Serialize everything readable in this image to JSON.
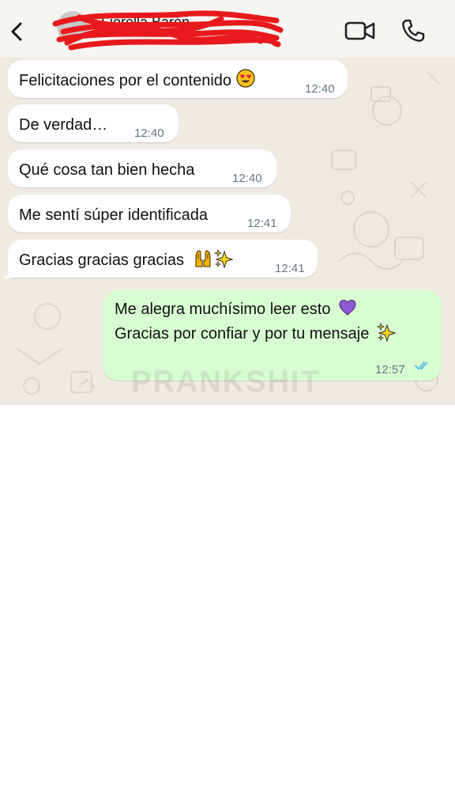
{
  "chat": {
    "contact_name": "Fiorella Barón",
    "messages_in": [
      {
        "text": "Felicitaciones por el contenido",
        "time": "12:40"
      },
      {
        "text": "De verdad…",
        "time": "12:40"
      },
      {
        "text": "Qué cosa tan bien hecha",
        "time": "12:40"
      },
      {
        "text": "Me sentí súper identificada",
        "time": "12:41"
      },
      {
        "text": "Gracias gracias gracias",
        "time": "12:41"
      }
    ],
    "message_out": {
      "line1": "Me alegra muchísimo leer esto",
      "line2": "Gracias por confiar y por tu mensaje",
      "time": "12:57",
      "status": "read"
    }
  },
  "icons": {
    "back": "chevron-left-icon",
    "video": "video-camera-icon",
    "call": "phone-icon",
    "heart_eyes": "heart-eyes-emoji",
    "raising_hands": "raising-hands-emoji",
    "sparkles": "sparkles-emoji",
    "purple_heart": "purple-heart-emoji",
    "read_receipt": "double-check-icon"
  },
  "watermark": "PRANKSHIT",
  "colors": {
    "wallpaper": "#efeae2",
    "incoming_bubble": "#ffffff",
    "outgoing_bubble": "#d9fdd3",
    "timestamp": "#667781",
    "read_tick": "#53bdeb",
    "redaction": "#e8191c"
  }
}
